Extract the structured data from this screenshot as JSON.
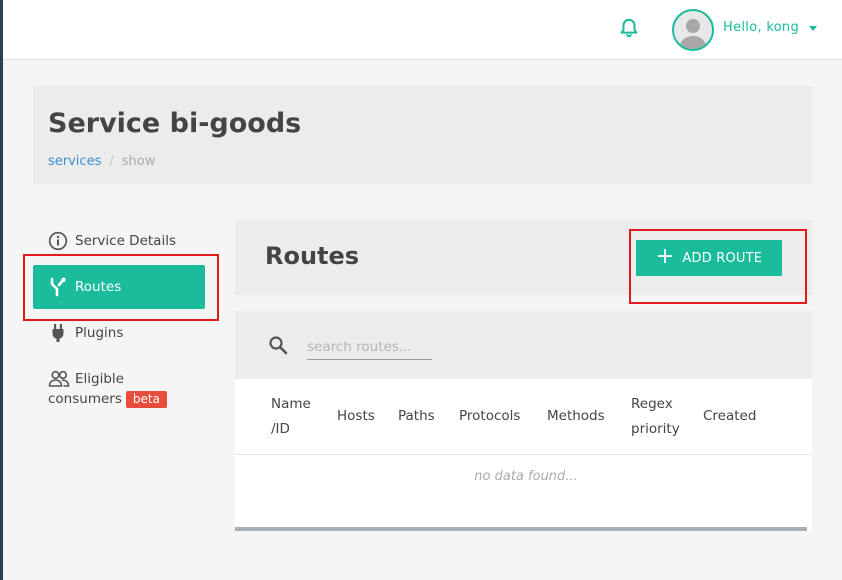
{
  "header": {
    "greeting": "Hello, kong"
  },
  "page": {
    "title": "Service bi-goods",
    "breadcrumb": [
      "services",
      "show"
    ]
  },
  "sidebar": {
    "items": [
      {
        "label": "Service Details",
        "icon": "info-icon"
      },
      {
        "label": "Routes",
        "icon": "route-fork-icon",
        "active": true
      },
      {
        "label": "Plugins",
        "icon": "plug-icon"
      },
      {
        "label_line1": "Eligible",
        "label_line2": "consumers",
        "badge": "beta",
        "icon": "users-icon"
      }
    ]
  },
  "routes": {
    "title": "Routes",
    "add_button": "ADD ROUTE",
    "search_placeholder": "search routes...",
    "columns": [
      {
        "line1": "Name",
        "line2": "/ID"
      },
      {
        "line1": "Hosts"
      },
      {
        "line1": "Paths"
      },
      {
        "line1": "Protocols"
      },
      {
        "line1": "Methods"
      },
      {
        "line1": "Regex",
        "line2": "priority"
      },
      {
        "line1": "Created"
      }
    ],
    "rows": [],
    "empty_text": "no data found..."
  },
  "colors": {
    "accent": "#1abc9c",
    "link": "#3a8fd0",
    "badge": "#e74c3c",
    "highlight": "#e01b1b"
  }
}
